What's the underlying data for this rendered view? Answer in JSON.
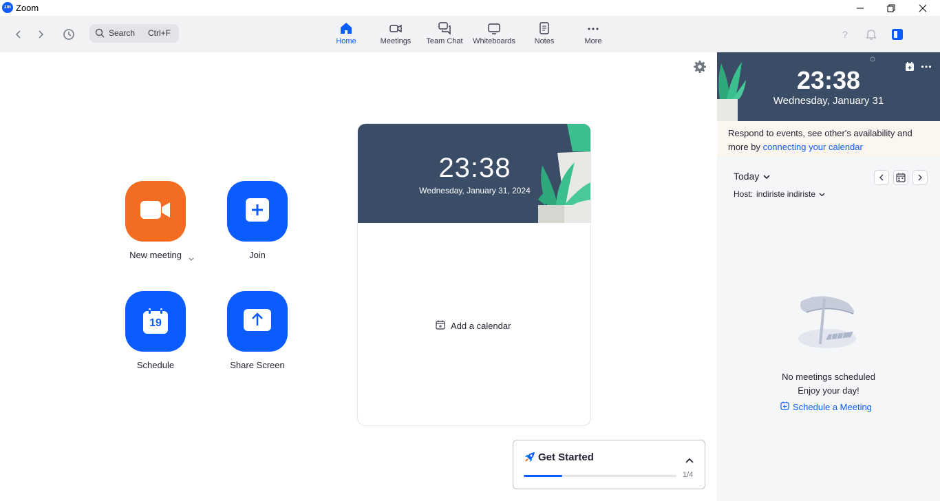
{
  "window": {
    "title": "Zoom",
    "logo_text": "zm"
  },
  "search": {
    "label": "Search",
    "shortcut": "Ctrl+F"
  },
  "tabs": [
    {
      "label": "Home",
      "icon": "home-icon",
      "active": true
    },
    {
      "label": "Meetings",
      "icon": "video-camera-icon"
    },
    {
      "label": "Team Chat",
      "icon": "chat-bubbles-icon"
    },
    {
      "label": "Whiteboards",
      "icon": "whiteboard-icon"
    },
    {
      "label": "Notes",
      "icon": "notes-icon"
    },
    {
      "label": "More",
      "icon": "more-dots-icon"
    }
  ],
  "actions": {
    "new_meeting": "New meeting",
    "join": "Join",
    "schedule": "Schedule",
    "schedule_day": "19",
    "share_screen": "Share Screen"
  },
  "calendar_card": {
    "time": "23:38",
    "date": "Wednesday, January 31, 2024",
    "add_calendar": "Add a calendar"
  },
  "get_started": {
    "title": "Get Started",
    "progress_text": "1/4",
    "progress_fraction": 0.25
  },
  "side_panel": {
    "time": "23:38",
    "date": "Wednesday, January 31",
    "info_text": "Respond to events, see other's availability and more by ",
    "info_link": "connecting your calendar",
    "today": "Today",
    "host_label": "Host:",
    "host_name": "indiriste indiriste",
    "empty_line1": "No meetings scheduled",
    "empty_line2": "Enjoy your day!",
    "schedule_link": "Schedule a Meeting"
  },
  "colors": {
    "brand": "#0b5cff",
    "orange": "#f26d21",
    "banner": "#3a4c66",
    "leaf": "#3bbf8f"
  }
}
